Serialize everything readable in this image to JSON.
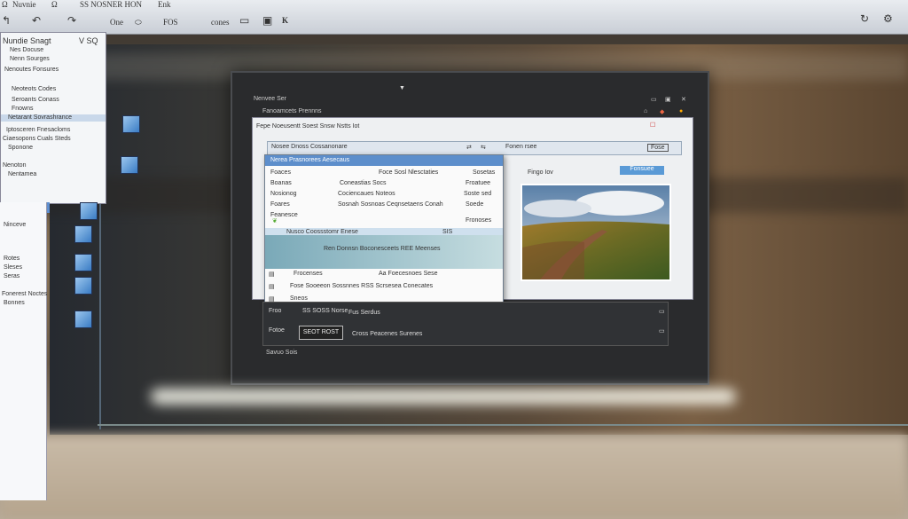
{
  "toolbar": {
    "items": [
      "Ω",
      "Nuvnie",
      "Ω",
      "SS NOSNER HON",
      "Enk"
    ],
    "row2": [
      "One",
      "⬭",
      "FOS",
      "cones",
      "K"
    ]
  },
  "left_panel": {
    "header": "Nundie  Snagt",
    "header_right": "V SQ",
    "lines": [
      "Nes Docuse",
      "Nenn Sourges",
      "Nenoutes Fonsures",
      "Neoteots    Codes",
      "Seroants    Conass",
      "Fnowns",
      "Netarant Sovrashrance",
      "Iptosceren Fnesacloms",
      "Ciaesopons Cuals Steds",
      "Sponone",
      "Nenoton",
      "Nentamea"
    ],
    "lower_lines": [
      "Ninceve",
      "Rotes",
      "Sleses",
      "Seras",
      "Fonerest Noctes",
      "Bonnes"
    ]
  },
  "main_window": {
    "title": "Nenvee Ser",
    "subtitle": "Fanoamcets  Prennns",
    "inner_title": "Fepe Noeusentt  Soest Snsw Nstts Iot",
    "address": "Nosee Dnoss  Cossanonare",
    "search_label": "Fonen rsee",
    "right_badge": "Fose",
    "preview_label": "Fingo Iov",
    "right_field": "Fonsuee"
  },
  "dropdown": {
    "header": "Nerea Prasnorees Aesecaus",
    "rows": [
      {
        "a": "Foaces",
        "b": "Foce Sosl Nlesctaties",
        "c": "Sosetas"
      },
      {
        "a": "Boanas",
        "b": "Coneastias Socs",
        "c": "Froatuee"
      },
      {
        "a": "Nosionog",
        "b": "Cociencaues Noteos",
        "c": "Soste sed"
      },
      {
        "a": "Foares",
        "b": "Sosnah Sosnoas Ceqnsetaens Conah",
        "c": "Soede"
      },
      {
        "a": "Feanesce",
        "b": "",
        "c": "Fronoses"
      }
    ],
    "selected": "Nusco Coossstomr Enese",
    "selected_right": "SIS",
    "banner": "Ren Donnsn Boconesceets REE Meenses",
    "footer_rows": [
      {
        "a": "Frocenses",
        "b": "Aa Foecesnoes Sese"
      },
      {
        "a": "Fose Sooeeon  Sossnnes  RSS Scrsesea  Conecates",
        "b": ""
      },
      {
        "a": "Sneos",
        "b": ""
      }
    ]
  },
  "bottom_area": {
    "line1_label": "Froo",
    "line1_value": "SS SOSS Norse",
    "line1_right": "Fus Serdus",
    "line2_label": "Fotoe",
    "field": "SEOT ROST",
    "line2_right": "Cross Peacenes Surenes",
    "status": "Savuo Sois"
  }
}
